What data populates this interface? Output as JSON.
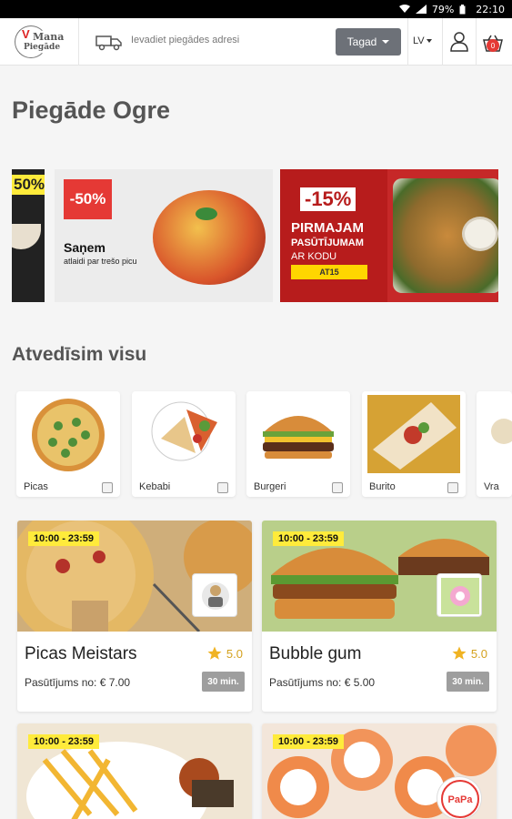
{
  "status_bar": {
    "battery": "79%",
    "time": "22:10"
  },
  "header": {
    "logo_line1": "Mana",
    "logo_line2": "Piegāde",
    "address_placeholder": "Ievadiet piegādes adresi",
    "time_selector": "Tagad",
    "language": "LV",
    "cart_count": "0"
  },
  "page_title": "Piegāde Ogre",
  "banners": [
    {
      "discount": "50%"
    },
    {
      "discount": "-50%",
      "title": "Saņem",
      "subtitle": "atlaidi par trešo picu"
    },
    {
      "discount": "-15%",
      "line1": "PIRMAJAM",
      "line2": "PASŪTĪJUMAM",
      "line3": "AR KODU",
      "code": "AT15"
    }
  ],
  "section_title": "Atvedīsim visu",
  "categories": [
    {
      "name": "Picas"
    },
    {
      "name": "Kebabi"
    },
    {
      "name": "Burgeri"
    },
    {
      "name": "Burito"
    },
    {
      "name": "Vra"
    }
  ],
  "restaurants": [
    {
      "hours": "10:00 - 23:59",
      "name": "Picas Meistars",
      "rating": "5.0",
      "min_order": "Pasūtījums no: € 7.00",
      "delivery_time": "30 min."
    },
    {
      "hours": "10:00 - 23:59",
      "name": "Bubble gum",
      "rating": "5.0",
      "min_order": "Pasūtījums no: € 5.00",
      "delivery_time": "30 min."
    },
    {
      "hours": "10:00 - 23:59"
    },
    {
      "hours": "10:00 - 23:59",
      "logo_text": "PaPa"
    }
  ],
  "colors": {
    "accent_red": "#e53935",
    "badge_yellow": "#ffeb3b",
    "button_gray": "#6d7178",
    "star": "#f0b323"
  }
}
